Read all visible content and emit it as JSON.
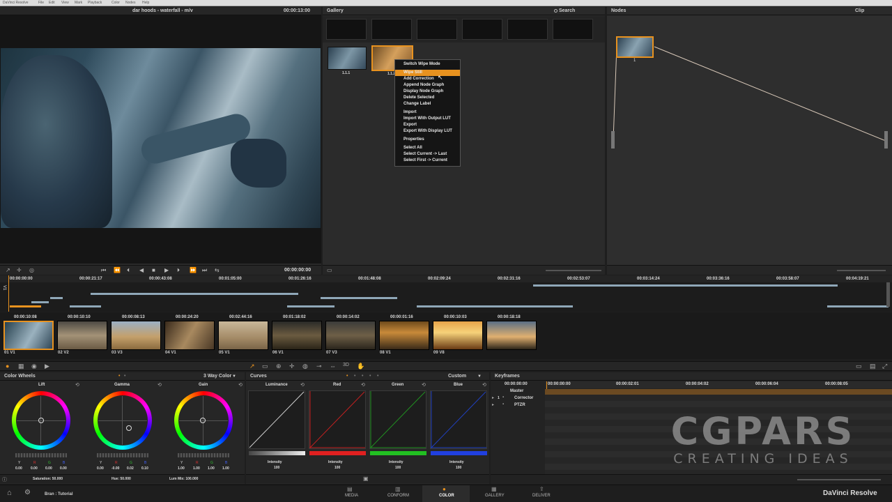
{
  "menubar": {
    "items": [
      "DaVinci Resolve",
      "File",
      "Edit",
      "View",
      "Mark",
      "Playback",
      "Color",
      "Nodes",
      "Help"
    ]
  },
  "viewer": {
    "title": "dar hoods - waterfall - m/v",
    "timecode": "00:00:13:00",
    "transport_timecode": "00:00:00:00"
  },
  "gallery": {
    "title": "Gallery",
    "search_label": "Search",
    "still_labels": [
      "1.1.1",
      "1.1.2"
    ]
  },
  "context_menu": {
    "items": [
      "Switch Wipe Mode",
      "Wipe Still",
      "Add Correction",
      "Append Node Graph",
      "Display Node Graph",
      "Delete Selected",
      "Change Label",
      "Import",
      "Import With Output LUT",
      "Export",
      "Export With Display LUT",
      "Properties",
      "Select All",
      "Select Current -> Last",
      "Select First -> Current"
    ],
    "highlighted": "Wipe Still"
  },
  "nodes": {
    "title": "Nodes",
    "mode": "Clip",
    "node_label": "1"
  },
  "timeline": {
    "timecodes": [
      "00:00:00:00",
      "00:00:21:17",
      "00:00:43:08",
      "00:01:05:00",
      "00:01:26:16",
      "00:01:48:08",
      "00:02:09:24",
      "00:02:31:16",
      "00:02:53:07",
      "00:03:14:24",
      "00:03:36:16",
      "00:03:58:07",
      "00:04:19:21"
    ],
    "track_label": "V1"
  },
  "clips": [
    {
      "tc": "00:00:10:08",
      "label": "01 V1"
    },
    {
      "tc": "00:00:10:10",
      "label": "02 V2"
    },
    {
      "tc": "00:00:08:13",
      "label": "03 V3"
    },
    {
      "tc": "00:00:24:20",
      "label": "04 V1"
    },
    {
      "tc": "00:02:44:16",
      "label": "05 V1"
    },
    {
      "tc": "00:01:18:02",
      "label": "06 V1"
    },
    {
      "tc": "00:00:14:02",
      "label": "07 V3"
    },
    {
      "tc": "00:00:01:16",
      "label": "08 V1"
    },
    {
      "tc": "00:00:10:03",
      "label": "09 V8"
    },
    {
      "tc": "00:00:18:18",
      "label": ""
    }
  ],
  "color_wheels": {
    "title": "Color Wheels",
    "mode": "3 Way Color",
    "wheels": [
      {
        "name": "Lift",
        "labels": [
          "Y",
          "R",
          "G",
          "B"
        ],
        "values": [
          "0.00",
          "0.00",
          "0.00",
          "0.00"
        ]
      },
      {
        "name": "Gamma",
        "labels": [
          "Y",
          "R",
          "G",
          "B"
        ],
        "values": [
          "0.00",
          "-0.00",
          "0.02",
          "0.10"
        ]
      },
      {
        "name": "Gain",
        "labels": [
          "Y",
          "R",
          "G",
          "B"
        ],
        "values": [
          "1.00",
          "1.00",
          "1.00",
          "1.00"
        ]
      }
    ],
    "saturation": "Saturation: 50.000",
    "hue": "Hue: 50.000",
    "lum_mix": "Lum Mix: 100.000"
  },
  "curves": {
    "title": "Curves",
    "mode": "Custom",
    "channels": [
      {
        "name": "Luminance",
        "intensity_label": "Intensity",
        "intensity": "100",
        "color": "#cfcfcf"
      },
      {
        "name": "Red",
        "intensity_label": "Intensity",
        "intensity": "100",
        "color": "#e02020"
      },
      {
        "name": "Green",
        "intensity_label": "Intensity",
        "intensity": "100",
        "color": "#22c022"
      },
      {
        "name": "Blue",
        "intensity_label": "Intensity",
        "intensity": "100",
        "color": "#2040e0"
      }
    ]
  },
  "keyframes": {
    "title": "Keyframes",
    "timecodes": [
      "00:00:00:00",
      "00:00:00:00",
      "00:00:02:01",
      "00:00:04:02",
      "00:00:06:04",
      "00:00:08:05"
    ],
    "master": "Master",
    "tracks": [
      "Corrector",
      "PTZR"
    ],
    "track_num": "1"
  },
  "watermark": {
    "title": "CGPARS",
    "subtitle": "CREATING IDEAS"
  },
  "bottom_nav": {
    "project": "Bran : Tutorial",
    "tabs": [
      "MEDIA",
      "CONFORM",
      "COLOR",
      "GALLERY",
      "DELIVER"
    ],
    "active": "COLOR",
    "brand": "DaVinci Resolve"
  },
  "colors": {
    "accent": "#e8921f",
    "background": "#1e1e1e",
    "panel": "#2b2b2b"
  }
}
